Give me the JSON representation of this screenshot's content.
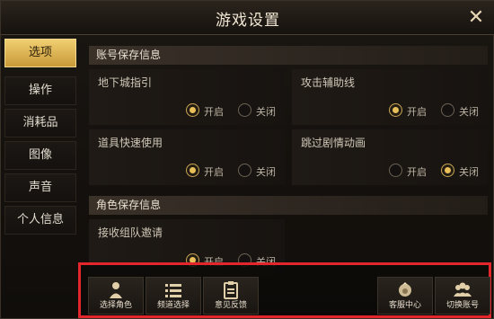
{
  "window": {
    "title": "游戏设置"
  },
  "sidebar": {
    "tabs": [
      {
        "label": "选项",
        "active": true
      },
      {
        "label": "操作",
        "active": false
      },
      {
        "label": "消耗品",
        "active": false
      },
      {
        "label": "图像",
        "active": false
      },
      {
        "label": "声音",
        "active": false
      },
      {
        "label": "个人信息",
        "active": false
      }
    ]
  },
  "sections": [
    {
      "title": "账号保存信息"
    },
    {
      "title": "角色保存信息"
    }
  ],
  "settings": [
    {
      "label": "地下城指引",
      "on_label": "开启",
      "off_label": "关闭",
      "selected": "on"
    },
    {
      "label": "攻击辅助线",
      "on_label": "开启",
      "off_label": "关闭",
      "selected": "on"
    },
    {
      "label": "道具快速使用",
      "on_label": "开启",
      "off_label": "关闭",
      "selected": "on"
    },
    {
      "label": "跳过剧情动画",
      "on_label": "开启",
      "off_label": "关闭",
      "selected": "off"
    },
    {
      "label": "接收组队邀请",
      "on_label": "开启",
      "off_label": "关闭",
      "selected": "on"
    }
  ],
  "bottom_buttons": [
    {
      "label": "选择角色",
      "icon": "character-select-icon"
    },
    {
      "label": "频道选择",
      "icon": "channel-list-icon"
    },
    {
      "label": "意见反馈",
      "icon": "feedback-icon"
    },
    {
      "label": "客服中心",
      "icon": "customer-service-icon"
    },
    {
      "label": "切换账号",
      "icon": "switch-account-icon"
    }
  ],
  "colors": {
    "accent": "#e8bf58",
    "active_tab": "#d9ad4a",
    "highlight_border": "#e2262b"
  }
}
